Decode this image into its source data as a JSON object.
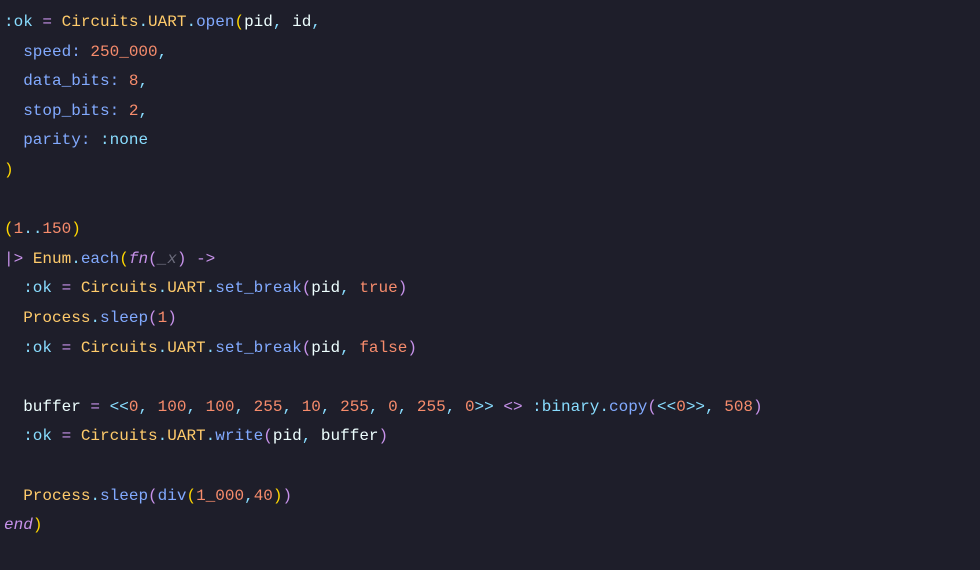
{
  "code": {
    "l1": {
      "ok": ":ok",
      "eq": " = ",
      "m1": "Circuits",
      "d1": ".",
      "m2": "UART",
      "d2": ".",
      "fn": "open",
      "lp": "(",
      "a1": "pid",
      "c1": ", ",
      "a2": "id",
      "c2": ",",
      "rp": ""
    },
    "l2": {
      "indent": "  ",
      "key": "speed:",
      "sp": " ",
      "val": "250_000",
      "c": ","
    },
    "l3": {
      "indent": "  ",
      "key": "data_bits:",
      "sp": " ",
      "val": "8",
      "c": ","
    },
    "l4": {
      "indent": "  ",
      "key": "stop_bits:",
      "sp": " ",
      "val": "2",
      "c": ","
    },
    "l5": {
      "indent": "  ",
      "key": "parity:",
      "sp": " ",
      "val": ":none"
    },
    "l6": {
      "rp": ")"
    },
    "blank": "",
    "l8": {
      "lp": "(",
      "a": "1",
      "range": "..",
      "b": "150",
      "rp": ")"
    },
    "l9": {
      "pipe": "|> ",
      "mod": "Enum",
      "d": ".",
      "fn": "each",
      "lp": "(",
      "fnkw": "fn",
      "lp2": "(",
      "arg": "_x",
      "rp2": ")",
      "arrow": " ->"
    },
    "l10": {
      "indent": "  ",
      "ok": ":ok",
      "eq": " = ",
      "m1": "Circuits",
      "d1": ".",
      "m2": "UART",
      "d2": ".",
      "fn": "set_break",
      "lp": "(",
      "a1": "pid",
      "c": ", ",
      "a2": "true",
      "rp": ")"
    },
    "l11": {
      "indent": "  ",
      "mod": "Process",
      "d": ".",
      "fn": "sleep",
      "lp": "(",
      "a": "1",
      "rp": ")"
    },
    "l12": {
      "indent": "  ",
      "ok": ":ok",
      "eq": " = ",
      "m1": "Circuits",
      "d1": ".",
      "m2": "UART",
      "d2": ".",
      "fn": "set_break",
      "lp": "(",
      "a1": "pid",
      "c": ", ",
      "a2": "false",
      "rp": ")"
    },
    "l14": {
      "indent": "  ",
      "var": "buffer",
      "eq": " = ",
      "lb": "<<",
      "n0": "0",
      "c0": ", ",
      "n1": "100",
      "c1": ", ",
      "n2": "100",
      "c2": ", ",
      "n3": "255",
      "c3": ", ",
      "n4": "10",
      "c4": ", ",
      "n5": "255",
      "c5": ", ",
      "n6": "0",
      "c6": ", ",
      "n7": "255",
      "c7": ", ",
      "n8": "0",
      "rb": ">>",
      "concat": " <> ",
      "atom": ":binary",
      "d": ".",
      "fn": "copy",
      "lp": "(",
      "lb2": "<<",
      "z": "0",
      "rb2": ">>",
      "c": ", ",
      "cnt": "508",
      "rp": ")"
    },
    "l15": {
      "indent": "  ",
      "ok": ":ok",
      "eq": " = ",
      "m1": "Circuits",
      "d1": ".",
      "m2": "UART",
      "d2": ".",
      "fn": "write",
      "lp": "(",
      "a1": "pid",
      "c": ", ",
      "a2": "buffer",
      "rp": ")"
    },
    "l17": {
      "indent": "  ",
      "mod": "Process",
      "d": ".",
      "fn": "sleep",
      "lp": "(",
      "div": "div",
      "lp2": "(",
      "a": "1_000",
      "c": ",",
      "b": "40",
      "rp2": ")",
      "rp": ")"
    },
    "l18": {
      "end": "end",
      "rp": ")"
    }
  }
}
